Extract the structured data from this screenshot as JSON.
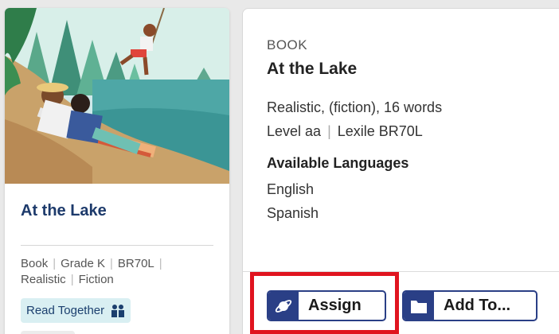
{
  "card": {
    "title": "At the Lake",
    "meta": [
      "Book",
      "Grade K",
      "BR70L",
      "Realistic",
      "Fiction"
    ],
    "tag": {
      "label": "Read Together",
      "icon": "people-reading-icon"
    }
  },
  "panel": {
    "type_label": "BOOK",
    "title": "At the Lake",
    "description_line1": "Realistic, (fiction), 16 words",
    "level": "Level aa",
    "lexile": "Lexile BR70L",
    "languages_heading": "Available Languages",
    "languages": [
      "English",
      "Spanish"
    ]
  },
  "actions": {
    "assign_label": "Assign",
    "assign_icon": "planet-icon",
    "add_to_label": "Add To...",
    "add_to_icon": "folder-icon",
    "highlight_color": "#e0141f"
  },
  "colors": {
    "accent": "#2a3f86",
    "title": "#1d3a6b",
    "tag_bg": "#d9eff2"
  }
}
